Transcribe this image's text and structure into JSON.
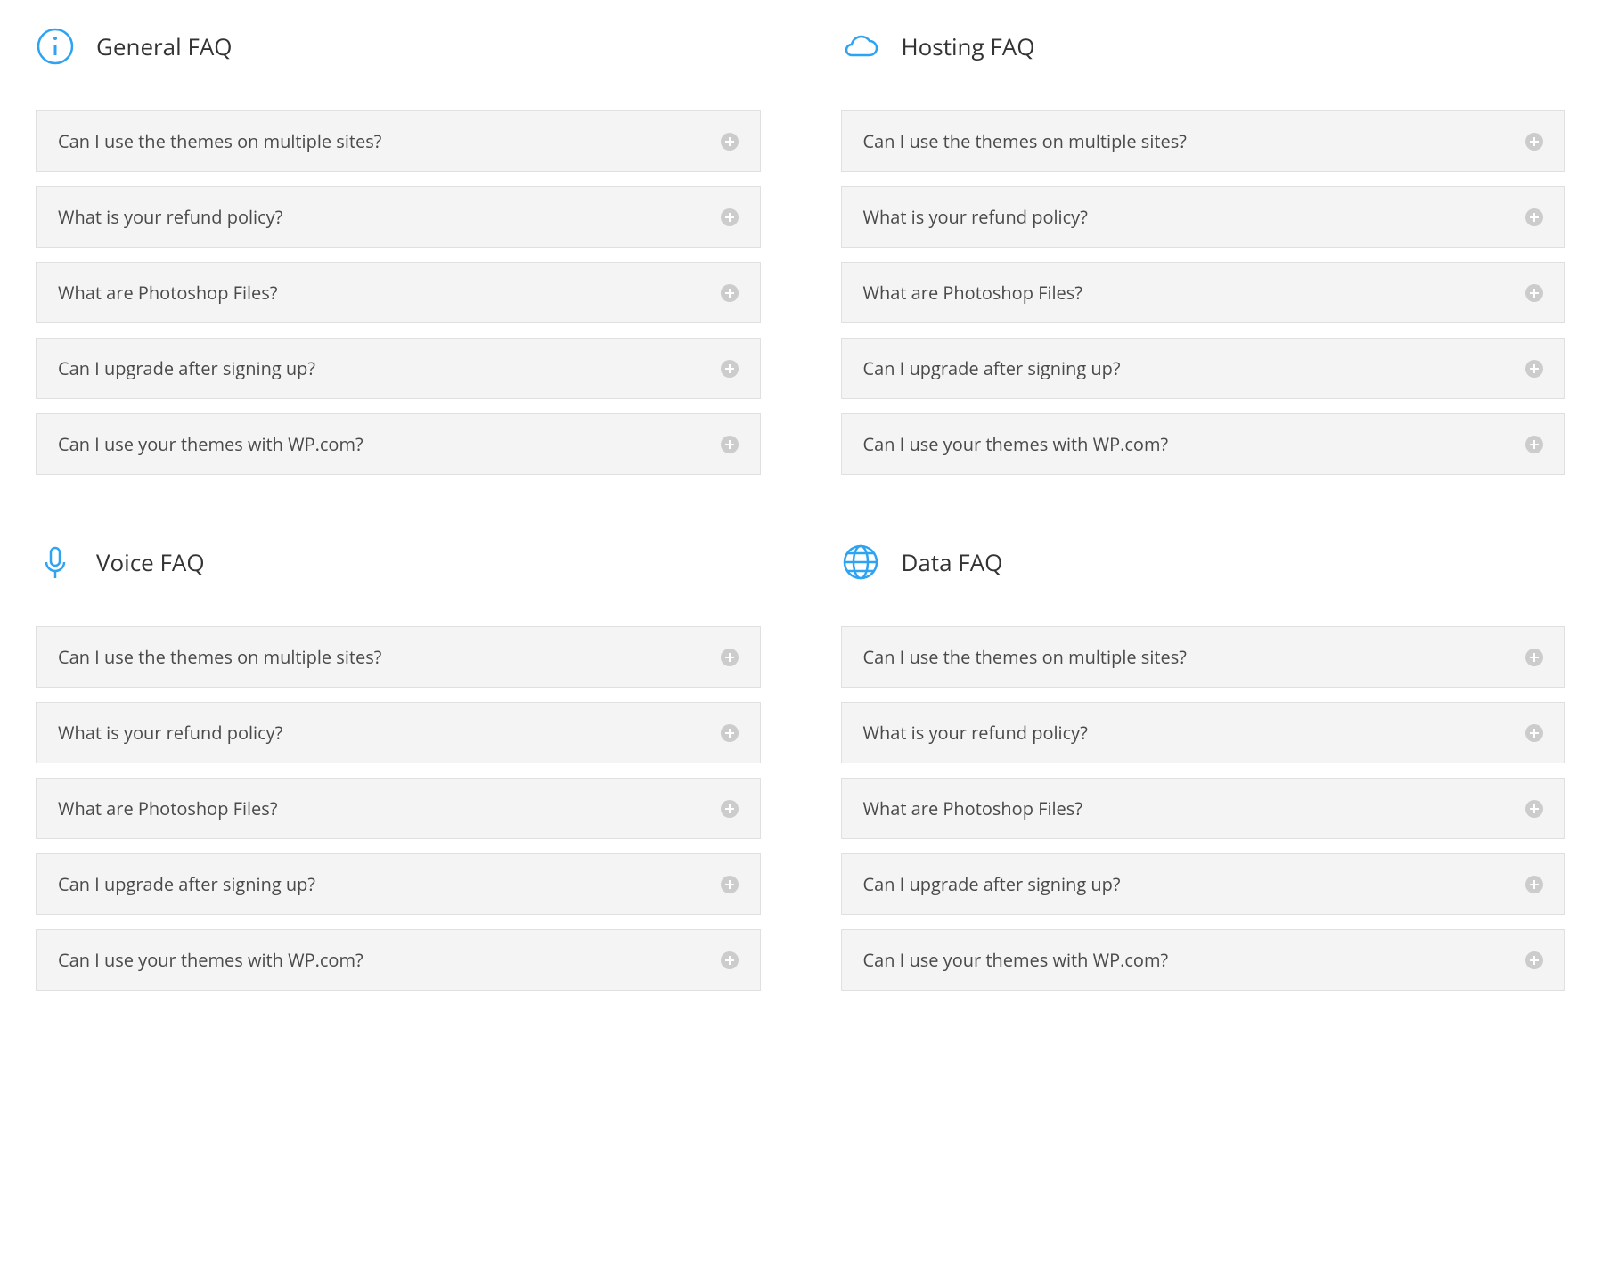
{
  "sections": [
    {
      "title": "General FAQ",
      "icon": "info-icon",
      "items": [
        {
          "q": "Can I use the themes on multiple sites?"
        },
        {
          "q": "What is your refund policy?"
        },
        {
          "q": "What are Photoshop Files?"
        },
        {
          "q": "Can I upgrade after signing up?"
        },
        {
          "q": "Can I use your themes with WP.com?"
        }
      ]
    },
    {
      "title": "Hosting FAQ",
      "icon": "cloud-icon",
      "items": [
        {
          "q": "Can I use the themes on multiple sites?"
        },
        {
          "q": "What is your refund policy?"
        },
        {
          "q": "What are Photoshop Files?"
        },
        {
          "q": "Can I upgrade after signing up?"
        },
        {
          "q": "Can I use your themes with WP.com?"
        }
      ]
    },
    {
      "title": "Voice FAQ",
      "icon": "mic-icon",
      "items": [
        {
          "q": "Can I use the themes on multiple sites?"
        },
        {
          "q": "What is your refund policy?"
        },
        {
          "q": "What are Photoshop Files?"
        },
        {
          "q": "Can I upgrade after signing up?"
        },
        {
          "q": "Can I use your themes with WP.com?"
        }
      ]
    },
    {
      "title": "Data FAQ",
      "icon": "globe-icon",
      "items": [
        {
          "q": "Can I use the themes on multiple sites?"
        },
        {
          "q": "What is your refund policy?"
        },
        {
          "q": "What are Photoshop Files?"
        },
        {
          "q": "Can I upgrade after signing up?"
        },
        {
          "q": "Can I use your themes with WP.com?"
        }
      ]
    }
  ]
}
